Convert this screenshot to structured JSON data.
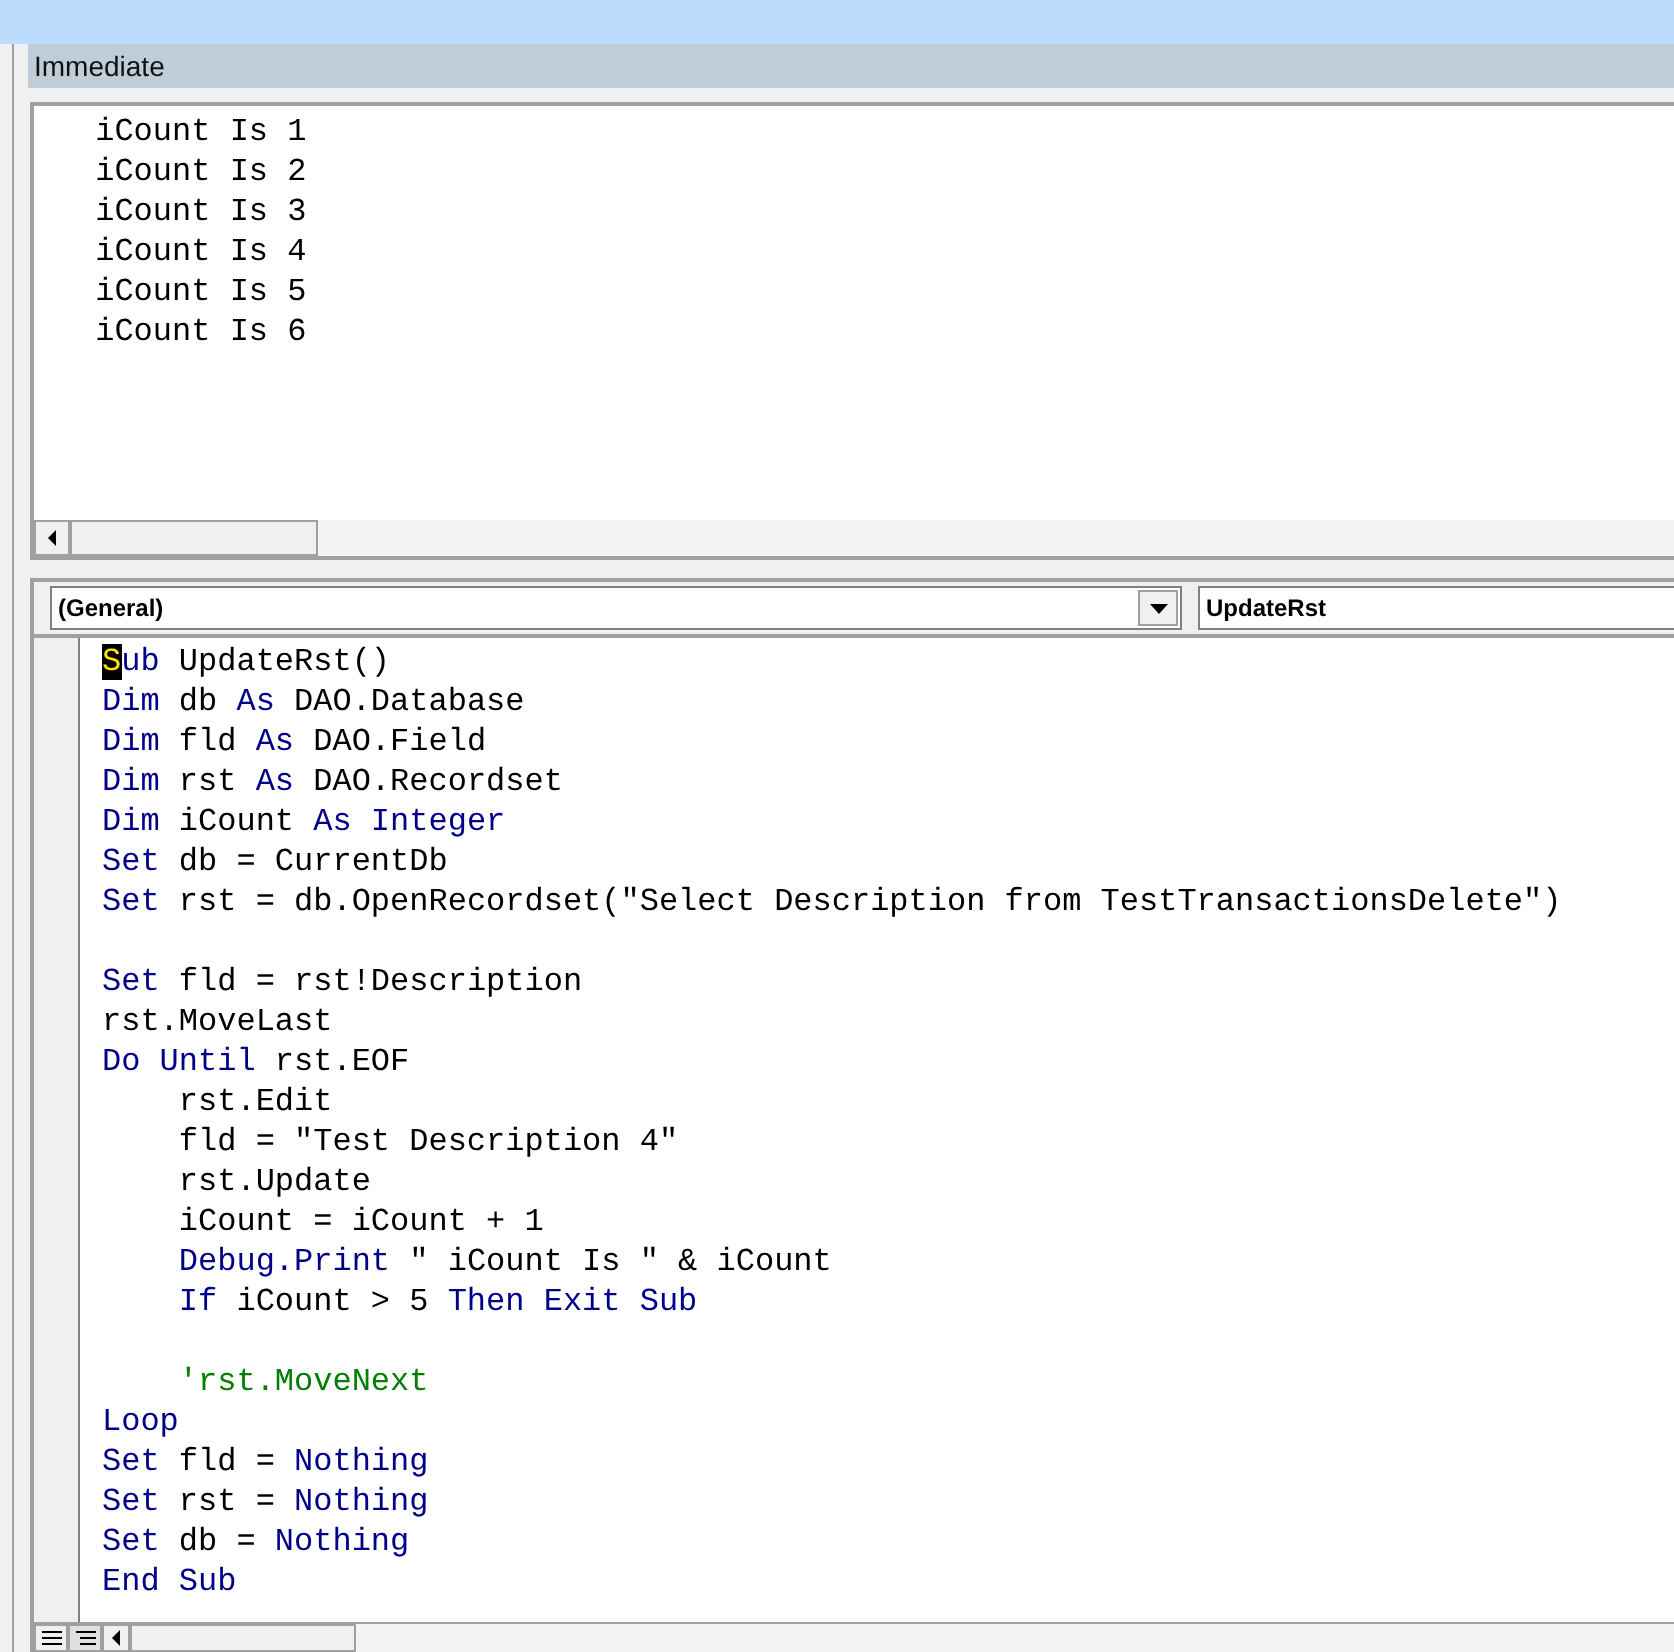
{
  "immediate": {
    "title": "Immediate",
    "lines": [
      " iCount Is 1",
      " iCount Is 2",
      " iCount Is 3",
      " iCount Is 4",
      " iCount Is 5",
      " iCount Is 6"
    ]
  },
  "code_window": {
    "object_dropdown": "(General)",
    "procedure_dropdown": "UpdateRst",
    "lines": [
      {
        "segments": [
          {
            "kind": "cursor",
            "text": "S"
          },
          {
            "kind": "keyword",
            "text": "ub"
          },
          {
            "kind": "plain",
            "text": " UpdateRst()"
          }
        ]
      },
      {
        "segments": [
          {
            "kind": "keyword",
            "text": "Dim"
          },
          {
            "kind": "plain",
            "text": " db "
          },
          {
            "kind": "keyword",
            "text": "As"
          },
          {
            "kind": "plain",
            "text": " DAO.Database"
          }
        ]
      },
      {
        "segments": [
          {
            "kind": "keyword",
            "text": "Dim"
          },
          {
            "kind": "plain",
            "text": " fld "
          },
          {
            "kind": "keyword",
            "text": "As"
          },
          {
            "kind": "plain",
            "text": " DAO.Field"
          }
        ]
      },
      {
        "segments": [
          {
            "kind": "keyword",
            "text": "Dim"
          },
          {
            "kind": "plain",
            "text": " rst "
          },
          {
            "kind": "keyword",
            "text": "As"
          },
          {
            "kind": "plain",
            "text": " DAO.Recordset"
          }
        ]
      },
      {
        "segments": [
          {
            "kind": "keyword",
            "text": "Dim"
          },
          {
            "kind": "plain",
            "text": " iCount "
          },
          {
            "kind": "keyword",
            "text": "As Integer"
          }
        ]
      },
      {
        "segments": [
          {
            "kind": "keyword",
            "text": "Set"
          },
          {
            "kind": "plain",
            "text": " db = CurrentDb"
          }
        ]
      },
      {
        "segments": [
          {
            "kind": "keyword",
            "text": "Set"
          },
          {
            "kind": "plain",
            "text": " rst = db.OpenRecordset(\"Select Description from TestTransactionsDelete\")"
          }
        ]
      },
      {
        "kind": "blank"
      },
      {
        "segments": [
          {
            "kind": "keyword",
            "text": "Set"
          },
          {
            "kind": "plain",
            "text": " fld = rst!Description"
          }
        ]
      },
      {
        "segments": [
          {
            "kind": "plain",
            "text": "rst.MoveLast"
          }
        ]
      },
      {
        "segments": [
          {
            "kind": "keyword",
            "text": "Do Until"
          },
          {
            "kind": "plain",
            "text": " rst.EOF"
          }
        ]
      },
      {
        "indented": true,
        "segments": [
          {
            "kind": "plain",
            "text": "rst.Edit"
          }
        ]
      },
      {
        "indented": true,
        "segments": [
          {
            "kind": "plain",
            "text": "fld = \"Test Description 4\""
          }
        ]
      },
      {
        "indented": true,
        "segments": [
          {
            "kind": "plain",
            "text": "rst.Update"
          }
        ]
      },
      {
        "indented": true,
        "segments": [
          {
            "kind": "plain",
            "text": "iCount = iCount + 1"
          }
        ]
      },
      {
        "indented": true,
        "segments": [
          {
            "kind": "keyword",
            "text": "Debug.Print"
          },
          {
            "kind": "plain",
            "text": " \" iCount Is \" & iCount"
          }
        ]
      },
      {
        "indented": true,
        "segments": [
          {
            "kind": "keyword",
            "text": "If"
          },
          {
            "kind": "plain",
            "text": " iCount > 5 "
          },
          {
            "kind": "keyword",
            "text": "Then Exit Sub"
          }
        ]
      },
      {
        "kind": "blank"
      },
      {
        "indented": true,
        "segments": [
          {
            "kind": "comment",
            "text": "'rst.MoveNext"
          }
        ]
      },
      {
        "segments": [
          {
            "kind": "keyword",
            "text": "Loop"
          }
        ]
      },
      {
        "segments": [
          {
            "kind": "keyword",
            "text": "Set"
          },
          {
            "kind": "plain",
            "text": " fld = "
          },
          {
            "kind": "keyword",
            "text": "Nothing"
          }
        ]
      },
      {
        "segments": [
          {
            "kind": "keyword",
            "text": "Set"
          },
          {
            "kind": "plain",
            "text": " rst = "
          },
          {
            "kind": "keyword",
            "text": "Nothing"
          }
        ]
      },
      {
        "segments": [
          {
            "kind": "keyword",
            "text": "Set"
          },
          {
            "kind": "plain",
            "text": " db = "
          },
          {
            "kind": "keyword",
            "text": "Nothing"
          }
        ]
      },
      {
        "segments": [
          {
            "kind": "keyword",
            "text": "End Sub"
          }
        ]
      }
    ]
  }
}
